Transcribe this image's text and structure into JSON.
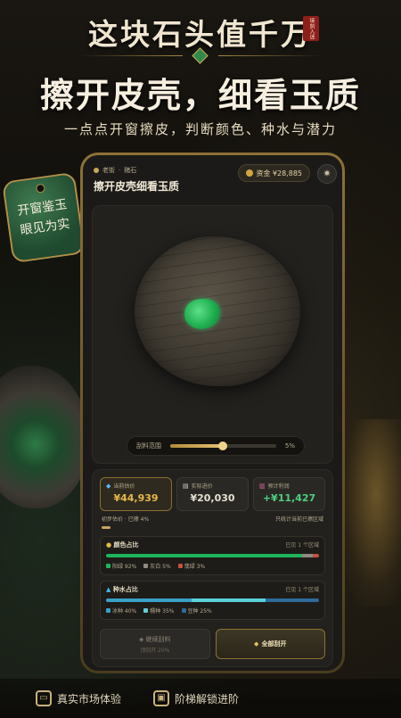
{
  "poster": {
    "title": "这块石头值千万",
    "seal_text": "琢刻入迷",
    "headline": "擦开皮壳，细看玉质",
    "subhead": "一点点开窗擦皮，判断颜色、种水与潜力",
    "tag_line1": "开窗鉴玉",
    "tag_line2": "眼见为实"
  },
  "app": {
    "breadcrumb": [
      "老街",
      "赌石"
    ],
    "title": "擦开皮壳细看玉质",
    "fund_label": "资金 ¥28,885",
    "settings_icon": "gear-icon"
  },
  "scrape": {
    "label": "刮料范围",
    "value_label": "5%",
    "fraction": 0.05
  },
  "stats": [
    {
      "label": "当前估价",
      "value": "¥44,939",
      "icon": "diamond-icon",
      "tone": "gold"
    },
    {
      "label": "实际进价",
      "value": "¥20,030",
      "icon": "receipt-icon",
      "tone": "white"
    },
    {
      "label": "预计利润",
      "value": "+¥11,427",
      "icon": "chart-icon",
      "tone": "green"
    }
  ],
  "prelim": {
    "left": "初步估价 · 已擦 4%",
    "right": "只统计当前已擦区域",
    "fraction": 0.04
  },
  "color_metric": {
    "title": "颜色占比",
    "sub": "已见 1 个区域",
    "legend": [
      {
        "label": "阳绿 92%",
        "color": "#1fb45a",
        "pct": 92
      },
      {
        "label": "灰白 5%",
        "color": "#8e8b84",
        "pct": 5
      },
      {
        "label": "翡绿 3%",
        "color": "#c4523d",
        "pct": 3
      }
    ]
  },
  "water_metric": {
    "title": "种水占比",
    "sub": "已见 1 个区域",
    "legend": [
      {
        "label": "冰种 40%",
        "color": "#3aa0c8",
        "pct": 40
      },
      {
        "label": "糯种 35%",
        "color": "#5bd0d8",
        "pct": 35
      },
      {
        "label": "豆种 25%",
        "color": "#2e6a9a",
        "pct": 25
      }
    ]
  },
  "buttons": {
    "continue_label": "继续刮料",
    "continue_sub": "顶刮开 20%",
    "reveal_label": "全部刮开"
  },
  "footer": {
    "left": "真实市场体验",
    "right": "阶梯解锁进阶"
  }
}
